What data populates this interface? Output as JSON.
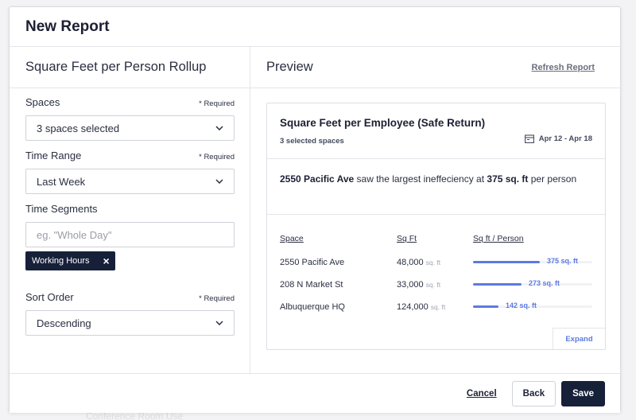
{
  "background": {
    "faded_items": [
      "Conference Room Use"
    ]
  },
  "modal": {
    "title": "New Report"
  },
  "left_panel": {
    "title": "Square Feet per Person Rollup",
    "required_text": "* Required",
    "spaces": {
      "label": "Spaces",
      "value": "3 spaces selected"
    },
    "time_range": {
      "label": "Time Range",
      "value": "Last Week"
    },
    "time_segments": {
      "label": "Time Segments",
      "placeholder": "eg. \"Whole Day\"",
      "tags": [
        {
          "label": "Working Hours"
        }
      ]
    },
    "sort_order": {
      "label": "Sort Order",
      "value": "Descending"
    }
  },
  "right_panel": {
    "title": "Preview",
    "refresh_label": "Refresh Report",
    "card": {
      "title": "Square Feet per Employee (Safe Return)",
      "subtitle": "3 selected spaces",
      "date_range": "Apr 12 - Apr 18",
      "insight": {
        "space": "2550 Pacific Ave",
        "text_mid": " saw the largest ineffeciency at ",
        "value": "375 sq. ft",
        "text_end": " per person"
      },
      "columns": [
        "Space",
        "Sq Ft",
        "Sq ft / Person"
      ],
      "rows": [
        {
          "space": "2550 Pacific Ave",
          "sqft": "48,000",
          "unit": "sq. ft",
          "per_person": 375,
          "per_person_label": "375 sq. ft"
        },
        {
          "space": "208 N Market St",
          "sqft": "33,000",
          "unit": "sq. ft",
          "per_person": 273,
          "per_person_label": "273 sq. ft"
        },
        {
          "space": "Albuquerque HQ",
          "sqft": "124,000",
          "unit": "sq. ft",
          "per_person": 142,
          "per_person_label": "142 sq. ft"
        }
      ],
      "expand_label": "Expand"
    }
  },
  "footer": {
    "cancel_label": "Cancel",
    "back_label": "Back",
    "save_label": "Save"
  },
  "colors": {
    "primary_dark": "#162039",
    "accent_blue": "#5c7ae0",
    "border": "#d9dbe1"
  }
}
